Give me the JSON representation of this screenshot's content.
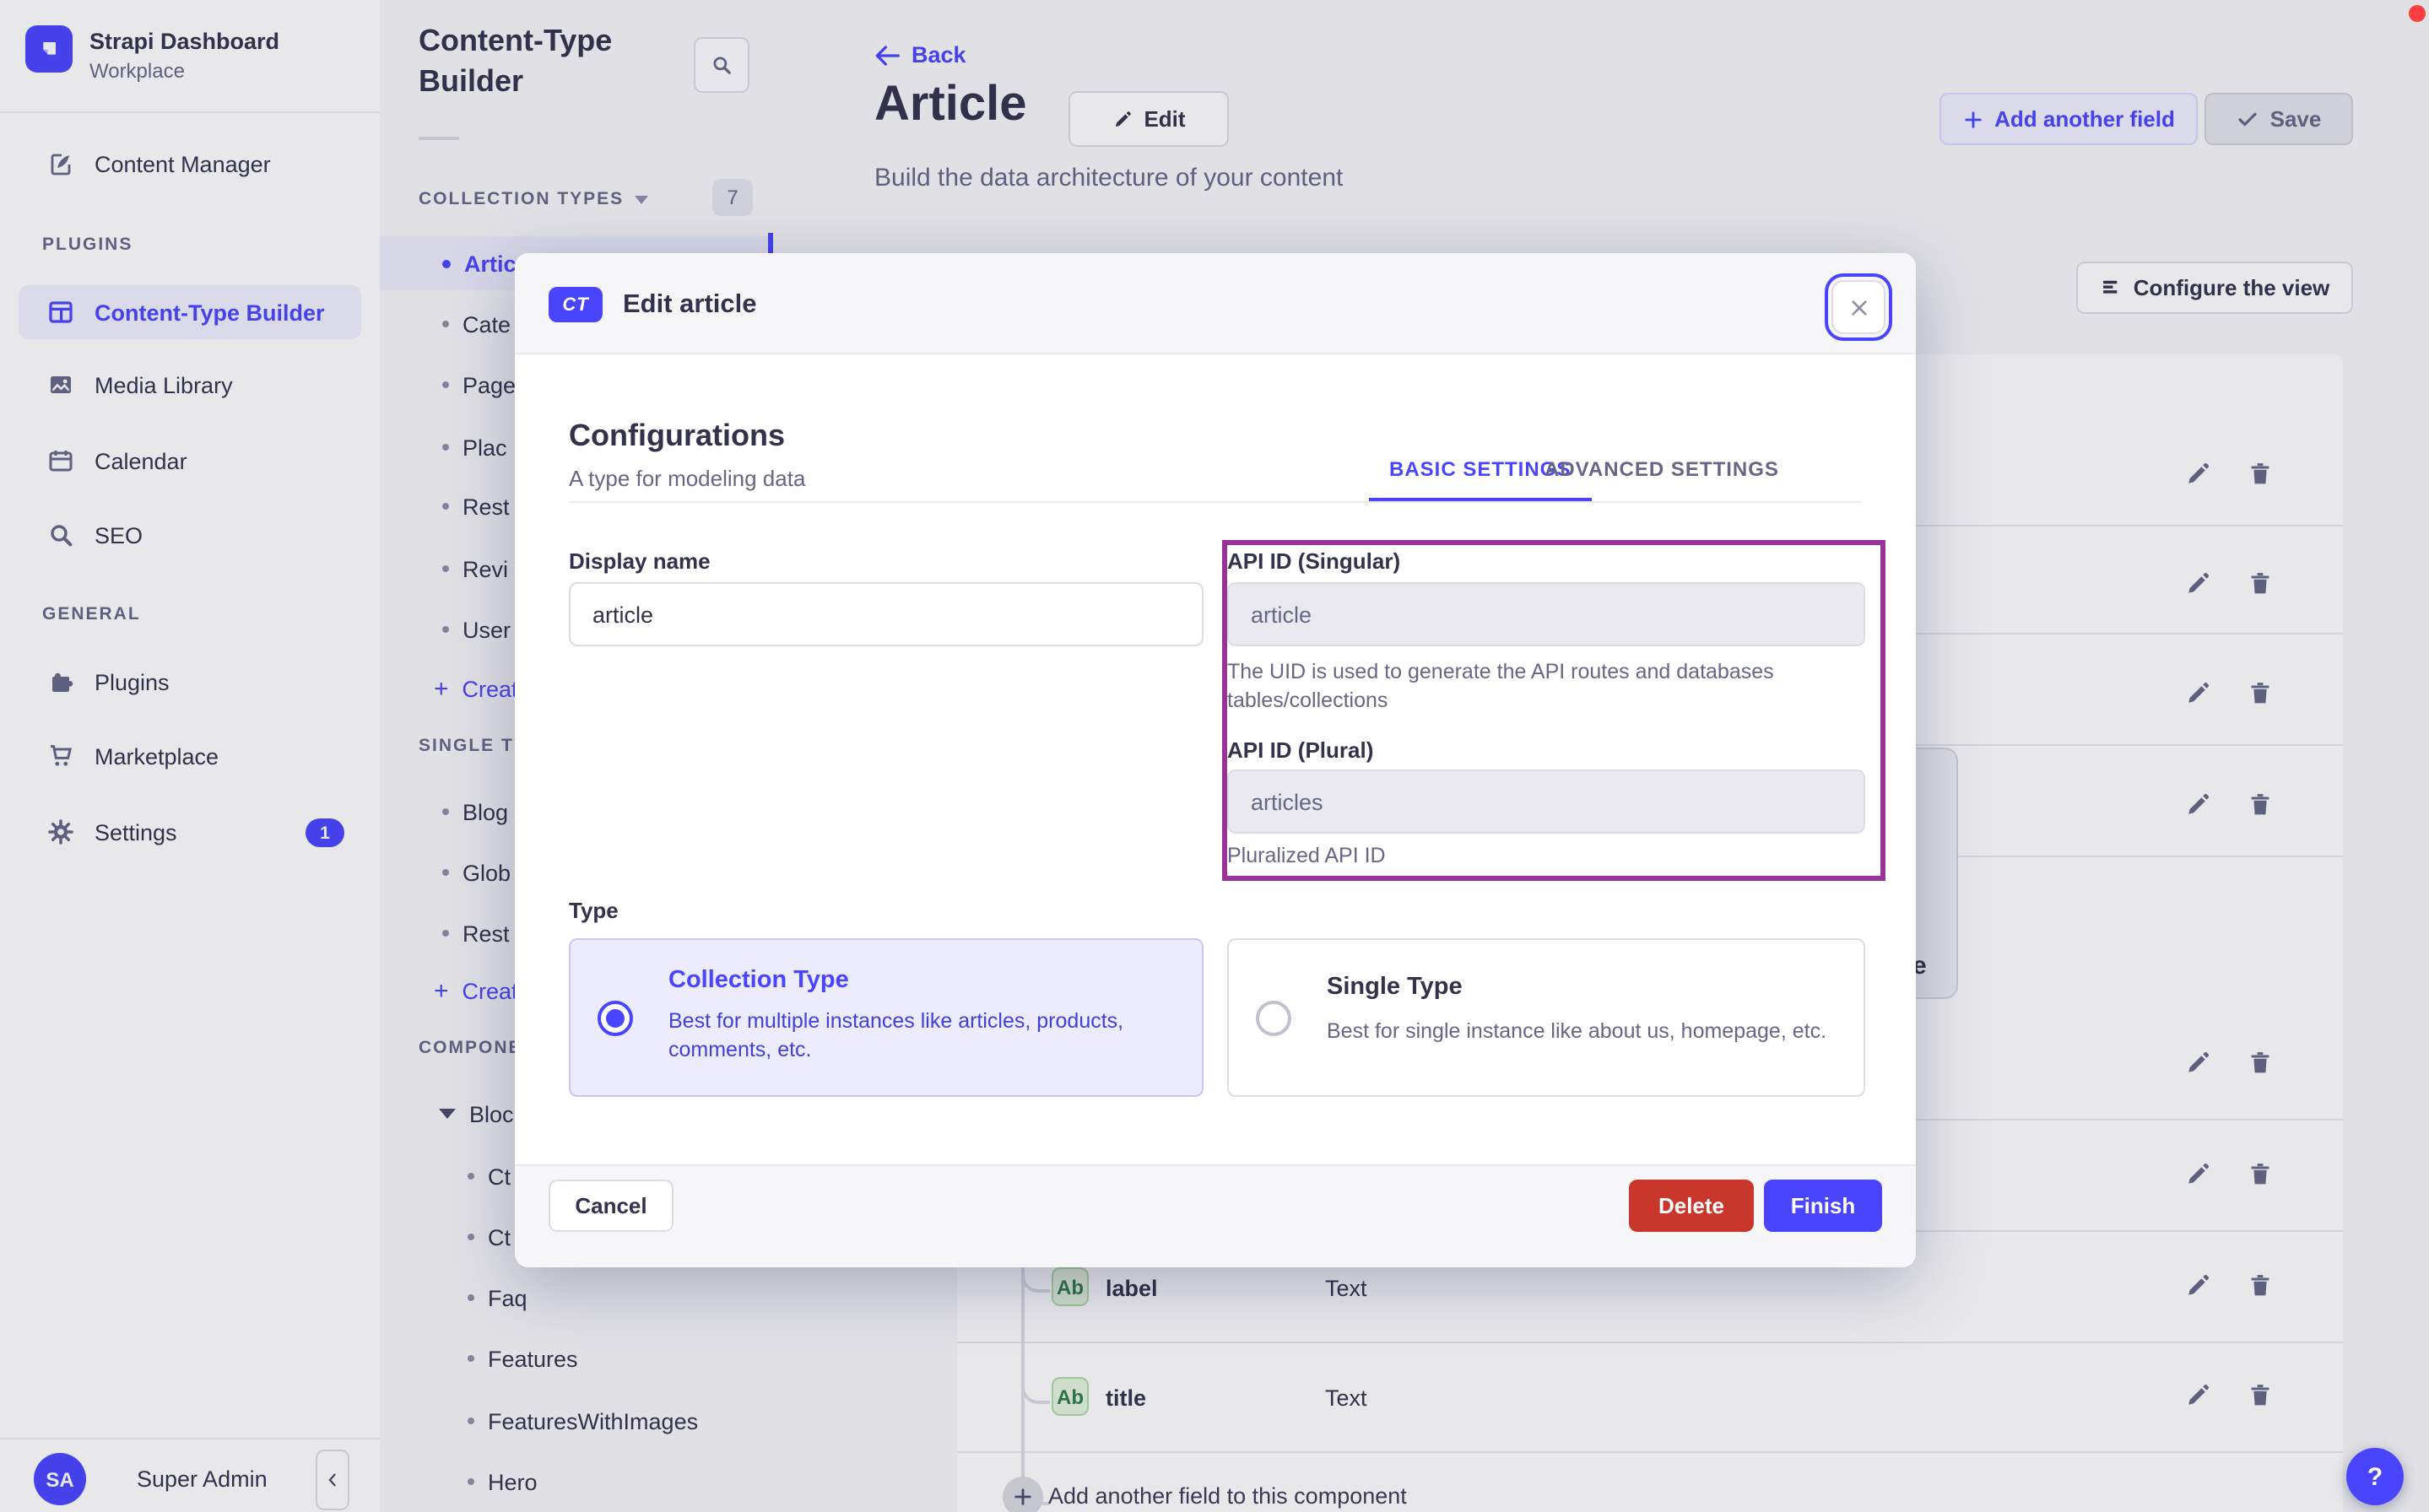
{
  "brand": {
    "title": "Strapi Dashboard",
    "subtitle": "Workplace"
  },
  "nav": {
    "content_manager": "Content Manager",
    "plugins_header": "PLUGINS",
    "plugins": [
      {
        "label": "Content-Type Builder"
      },
      {
        "label": "Media Library"
      },
      {
        "label": "Calendar"
      },
      {
        "label": "SEO"
      }
    ],
    "general_header": "GENERAL",
    "general": [
      {
        "label": "Plugins"
      },
      {
        "label": "Marketplace"
      },
      {
        "label": "Settings",
        "badge": "1"
      }
    ],
    "user": {
      "name": "Super Admin",
      "initials": "SA"
    }
  },
  "subnav": {
    "title": "Content-Type Builder",
    "collection_header": "COLLECTION TYPES",
    "collection_count": "7",
    "collection_items": [
      "Artic",
      "Cate",
      "Page",
      "Plac",
      "Rest",
      "Revi",
      "User"
    ],
    "create_collection": "Create",
    "single_header": "SINGLE TY",
    "single_items": [
      "Blog",
      "Glob",
      "Rest"
    ],
    "create_single": "Create",
    "components_header": "COMPONE",
    "component_group": "Bloc",
    "component_items": [
      "Ct",
      "Ct",
      "Faq",
      "Features",
      "FeaturesWithImages",
      "Hero"
    ]
  },
  "header": {
    "back": "Back",
    "title": "Article",
    "edit": "Edit",
    "subtitle": "Build the data architecture of your content",
    "add_field": "Add another field",
    "save": "Save",
    "configure": "Configure the view"
  },
  "modal": {
    "badge": "CT",
    "title": "Edit article",
    "section_title": "Configurations",
    "section_subtitle": "A type for modeling data",
    "tab_basic": "BASIC SETTINGS",
    "tab_advanced": "ADVANCED SETTINGS",
    "display_name_label": "Display name",
    "display_name_value": "article",
    "api_singular_label": "API ID (Singular)",
    "api_singular_value": "article",
    "api_singular_help_line1": "The UID is used to generate the API routes and databases",
    "api_singular_help_line2": "tables/collections",
    "api_plural_label": "API ID (Plural)",
    "api_plural_value": "articles",
    "api_plural_help": "Pluralized API ID",
    "type_label": "Type",
    "collection_type_title": "Collection Type",
    "collection_type_desc": "Best for multiple instances like articles, products, comments, etc.",
    "single_type_title": "Single Type",
    "single_type_desc": "Best for single instance like about us, homepage, etc.",
    "cancel": "Cancel",
    "delete": "Delete",
    "finish": "Finish"
  },
  "content": {
    "rows": [
      {
        "badge": "Ab",
        "name": "label",
        "type": "Text"
      },
      {
        "badge": "Ab",
        "name": "title",
        "type": "Text"
      }
    ],
    "add_row": "Add another field to this component",
    "bg_fragment": "e"
  },
  "help_label": "?",
  "colors": {
    "accent": "#4945ff",
    "danger": "#c9362c",
    "annotation": "#993399",
    "success": "#328048"
  }
}
